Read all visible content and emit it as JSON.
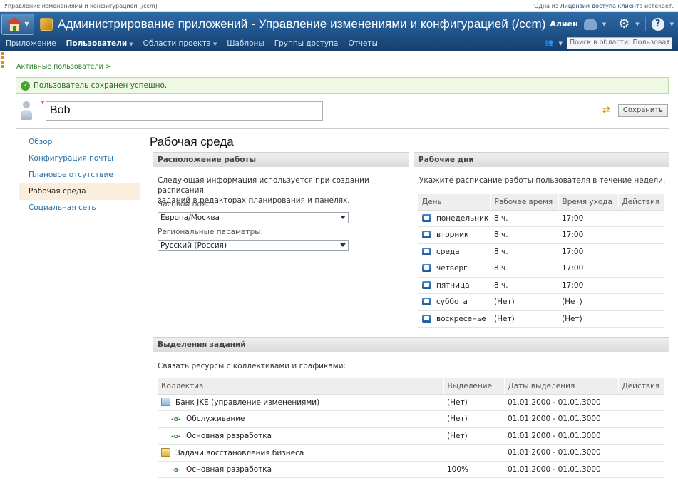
{
  "topbar": {
    "left": "Управление изменениями и конфигурацией (/ccm)",
    "right_prefix": "Одна из",
    "right_link": "Лицензий доступа клиента",
    "right_suffix": "истекает."
  },
  "banner": {
    "title": "Администрирование приложений - Управление изменениями и конфигурацией (/ccm)",
    "user": "Алиен"
  },
  "nav": {
    "items": [
      {
        "label": "Приложение"
      },
      {
        "label": "Пользователи"
      },
      {
        "label": "Области проекта"
      },
      {
        "label": "Шаблоны"
      },
      {
        "label": "Группы доступа"
      },
      {
        "label": "Отчеты"
      }
    ],
    "search_placeholder": "Поиск в области: Пользоват"
  },
  "breadcrumb": "Активные пользователи >",
  "success_message": "Пользователь сохранен успешно.",
  "user": {
    "name": "Bob",
    "required_marker": "*"
  },
  "save_label": "Сохранить",
  "sidebar": {
    "items": [
      {
        "label": "Обзор"
      },
      {
        "label": "Конфигурация почты"
      },
      {
        "label": "Плановое отсутствие"
      },
      {
        "label": "Рабочая среда"
      },
      {
        "label": "Социальная сеть"
      }
    ]
  },
  "page_title": "Рабочая среда",
  "work_location": {
    "heading": "Расположение работы",
    "info_line1": "Следующая информация используется при создании расписания",
    "info_line2": "заданий в редакторах планирования и панелях.",
    "timezone_label": "Часовой пояс:",
    "timezone_value": "Европа/Москва",
    "locale_label": "Региональные параметры:",
    "locale_value": "Русский (Россия)"
  },
  "work_days": {
    "heading": "Рабочие дни",
    "info": "Укажите расписание работы пользователя в течение недели.",
    "columns": [
      "День",
      "Рабочее время",
      "Время ухода",
      "Действия"
    ],
    "rows": [
      {
        "day": "понедельник",
        "hours": "8 ч.",
        "leave": "17:00"
      },
      {
        "day": "вторник",
        "hours": "8 ч.",
        "leave": "17:00"
      },
      {
        "day": "среда",
        "hours": "8 ч.",
        "leave": "17:00"
      },
      {
        "day": "четверг",
        "hours": "8 ч.",
        "leave": "17:00"
      },
      {
        "day": "пятница",
        "hours": "8 ч.",
        "leave": "17:00"
      },
      {
        "day": "суббота",
        "hours": "(Нет)",
        "leave": "(Нет)"
      },
      {
        "day": "воскресенье",
        "hours": "(Нет)",
        "leave": "(Нет)"
      }
    ]
  },
  "allocations": {
    "heading": "Выделения заданий",
    "info": "Связать ресурсы с коллективами и графиками:",
    "columns": [
      "Коллектив",
      "Выделение",
      "Даты выделения",
      "Действия"
    ],
    "rows": [
      {
        "name": "Банк JKE (управление изменениями)",
        "alloc": "(Нет)",
        "dates": "01.01.2000 - 01.01.3000",
        "kind": "team"
      },
      {
        "name": "Обслуживание",
        "alloc": "(Нет)",
        "dates": "01.01.2000 - 01.01.3000",
        "kind": "sub"
      },
      {
        "name": "Основная разработка",
        "alloc": "(Нет)",
        "dates": "01.01.2000 - 01.01.3000",
        "kind": "sub"
      },
      {
        "name": "Задачи восстановления бизнеса",
        "alloc": "",
        "dates": "01.01.2000 - 01.01.3000",
        "kind": "team2"
      },
      {
        "name": "Основная разработка",
        "alloc": "100%",
        "dates": "01.01.2000 - 01.01.3000",
        "kind": "sub"
      }
    ]
  }
}
